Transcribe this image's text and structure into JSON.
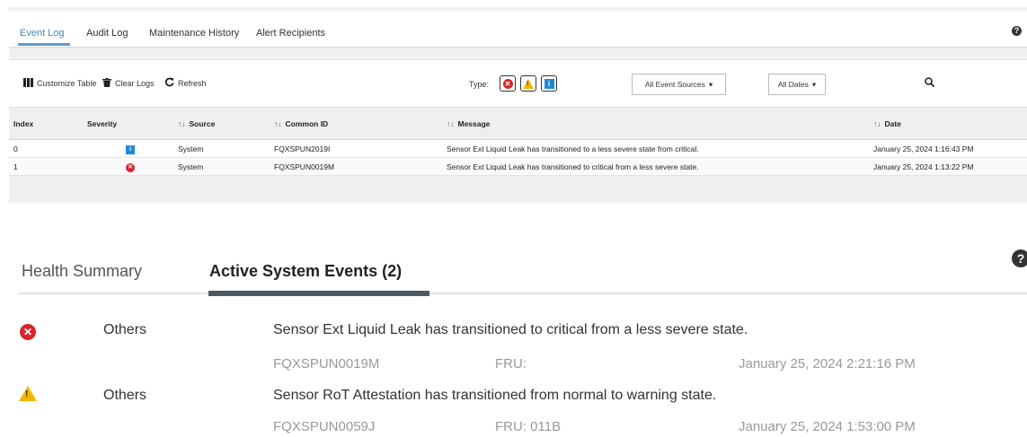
{
  "event_log": {
    "tabs": [
      "Event Log",
      "Audit Log",
      "Maintenance History",
      "Alert Recipients"
    ],
    "active_tab": "Event Log",
    "help_glyph": "?",
    "toolbar": {
      "customize_label": "Customize Table",
      "clear_label": "Clear Logs",
      "refresh_label": "Refresh",
      "type_label": "Type:",
      "sources_dropdown": "All Event Sources",
      "dates_dropdown": "All Dates"
    },
    "columns": [
      "Index",
      "Severity",
      "Source",
      "Common ID",
      "Message",
      "Date"
    ],
    "rows": [
      {
        "index": "0",
        "severity": "info",
        "source": "System",
        "common_id": "FQXSPUN2019I",
        "message": "Sensor Ext Liquid Leak has transitioned to a less severe state from critical.",
        "date": "January 25, 2024 1:16:43 PM"
      },
      {
        "index": "1",
        "severity": "error",
        "source": "System",
        "common_id": "FQXSPUN0019M",
        "message": "Sensor Ext Liquid Leak has transitioned to critical from a less severe state.",
        "date": "January 25, 2024 1:13:22 PM"
      }
    ]
  },
  "active_events": {
    "tabs": [
      "Health Summary",
      "Active System Events (2)"
    ],
    "active_tab": "Active System Events (2)",
    "events": [
      {
        "severity": "error",
        "type": "Others",
        "message": "Sensor Ext Liquid Leak has transitioned to critical from a less severe state.",
        "id": "FQXSPUN0019M",
        "fru": "FRU:",
        "date": "January 25, 2024 2:21:16 PM"
      },
      {
        "severity": "warning",
        "type": "Others",
        "message": "Sensor RoT Attestation has transitioned from normal to warning state.",
        "id": "FQXSPUN0059J",
        "fru": "FRU: 011B",
        "date": "January 25, 2024 1:53:00 PM"
      }
    ]
  },
  "colors": {
    "error": "#d9262c",
    "warning": "#f3b600",
    "info": "#1e88d8",
    "accent": "#3c8dbc"
  },
  "icons": [
    "columns-icon",
    "trash-icon",
    "refresh-icon",
    "error-icon",
    "warning-icon",
    "info-icon",
    "search-icon",
    "help-icon",
    "dropdown-caret-icon"
  ]
}
